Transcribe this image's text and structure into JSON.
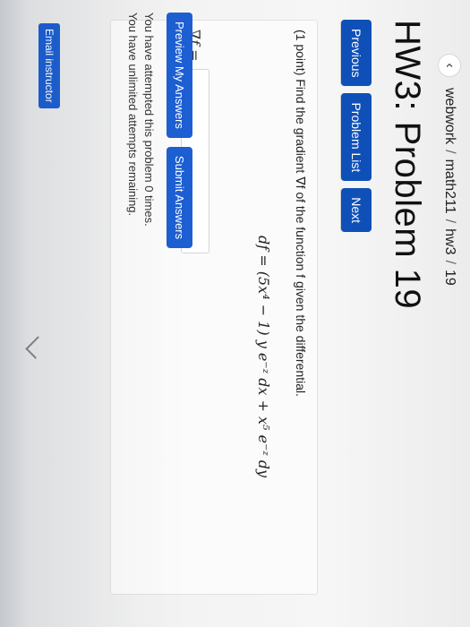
{
  "breadcrumb": {
    "back_icon": "chevron-left-icon",
    "items": [
      "webwork",
      "math211",
      "hw3",
      "19"
    ],
    "separator": "/"
  },
  "page": {
    "title": "HW3: Problem 19"
  },
  "nav": {
    "previous_label": "Previous",
    "problem_list_label": "Problem List",
    "next_label": "Next"
  },
  "problem": {
    "text": "(1 point) Find the gradient ∇f of the function f given the differential.",
    "equation": "df = (5x⁴ − 1) y e⁻ᶻ dx + x⁵ e⁻ᶻ dy",
    "answer_label": "∇f =",
    "answer_value": ""
  },
  "actions": {
    "preview_label": "Preview My Answers",
    "submit_label": "Submit Answers"
  },
  "status": {
    "line1": "You have attempted this problem 0 times.",
    "line2": "You have unlimited attempts remaining."
  },
  "footer": {
    "email_label": "Email instructor"
  }
}
